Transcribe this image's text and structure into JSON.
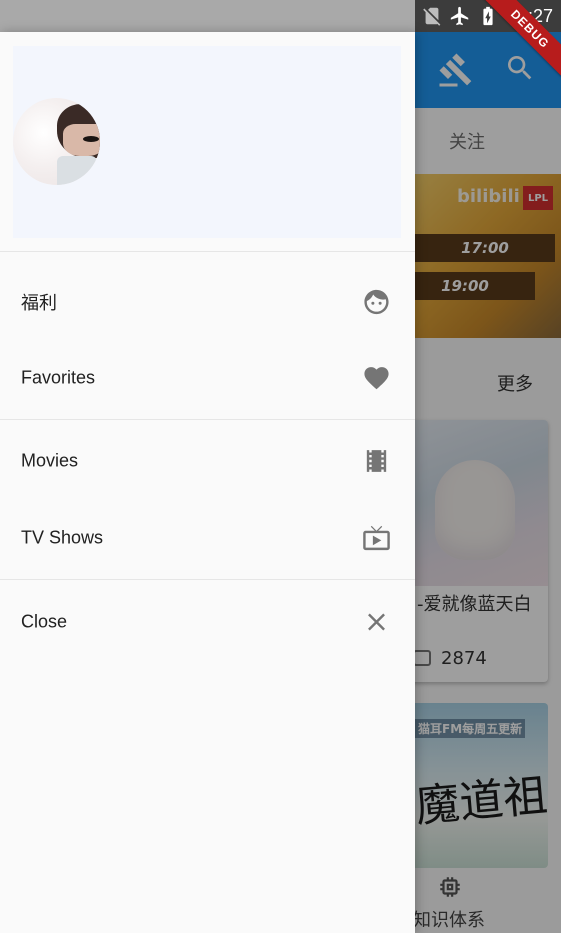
{
  "status_bar": {
    "time": "11:27",
    "debug_label": "DEBUG"
  },
  "background_app": {
    "tab_label": "关注",
    "banner_logo": "bilibili",
    "banner_badge": "LPL",
    "banner_times": [
      "17:00",
      "19:00"
    ],
    "section_more": "更多",
    "card1_title": "-爱就像蓝天白",
    "card1_count": "2874",
    "card2_banner": "猫耳FM每周五更新",
    "card2_callig": "魔道祖師",
    "bottom_nav_label": "知识体系"
  },
  "drawer": {
    "menu": [
      {
        "label": "福利",
        "icon": "face-icon"
      },
      {
        "label": "Favorites",
        "icon": "heart-icon"
      },
      {
        "label": "Movies",
        "icon": "movie-film-icon"
      },
      {
        "label": "TV Shows",
        "icon": "tv-icon"
      },
      {
        "label": "Close",
        "icon": "close-icon"
      }
    ]
  },
  "colors": {
    "appbar": "#2196f3",
    "drawer_bg": "#fafafa",
    "header_bg": "#f3f6fd",
    "icon": "#757575",
    "debug": "#b71c1c"
  }
}
